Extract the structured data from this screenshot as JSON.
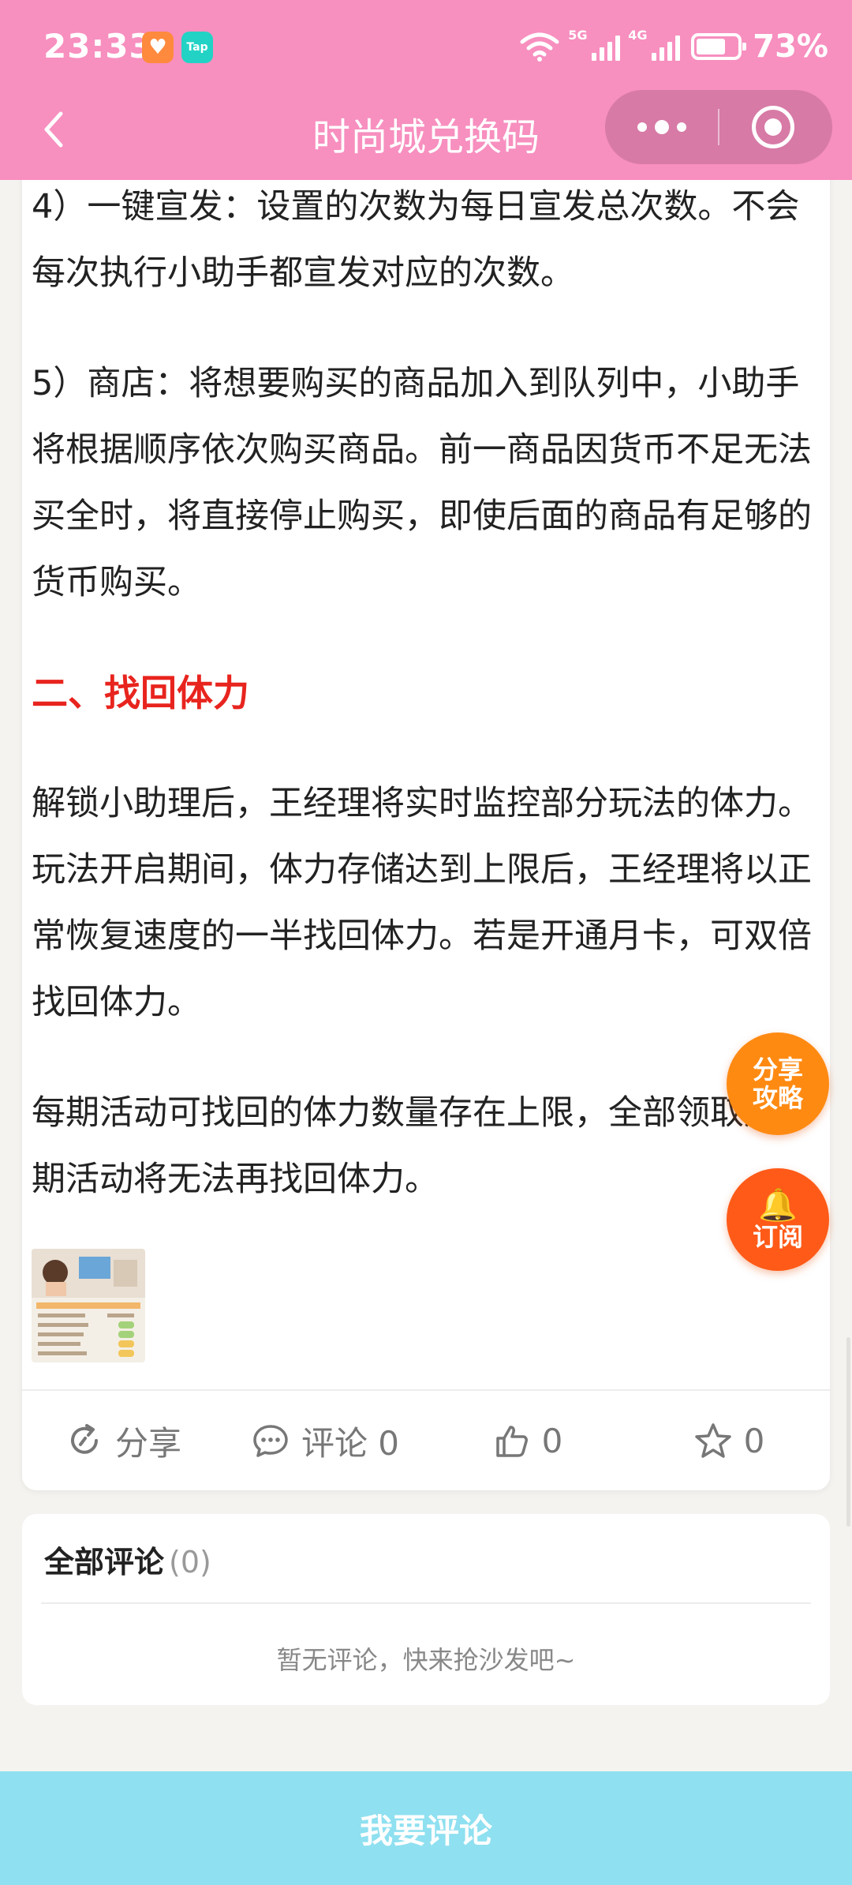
{
  "status_bar": {
    "time": "23:33",
    "net_5g": "5G",
    "net_4g": "4G",
    "battery": "73%",
    "battery_level": 0.73,
    "icons": [
      "heart-app-icon",
      "taptap-icon",
      "wifi-icon",
      "signal-icon",
      "battery-icon"
    ],
    "tap_label": "Tap"
  },
  "nav": {
    "title": "时尚城兑换码",
    "back_icon": "chevron-left-icon",
    "more_icon": "more-dots-icon",
    "close_icon": "miniapp-close-icon"
  },
  "article": {
    "paragraphs_top": [
      "4）一键宣发：设置的次数为每日宣发总次数。不会每次执行小助手都宣发对应的次数。",
      "5）商店：将想要购买的商品加入到队列中，小助手将根据顺序依次购买商品。前一商品因货币不足无法买全时，将直接停止购买，即使后面的商品有足够的货币购买。"
    ],
    "heading": "二、找回体力",
    "paragraphs_bottom": [
      "解锁小助理后，王经理将实时监控部分玩法的体力。玩法开启期间，体力存储达到上限后，王经理将以正常恢复速度的一半找回体力。若是开通月卡，可双倍找回体力。",
      "每期活动可找回的体力数量存在上限，全部领取后本期活动将无法再找回体力。"
    ],
    "heading_color": "#e8241e"
  },
  "actions": {
    "share_label": "分享",
    "comment_label": "评论 0",
    "like_count": "0",
    "fav_count": "0"
  },
  "comments": {
    "title": "全部评论",
    "count": "(0)",
    "empty_text": "暂无评论，快来抢沙发吧~"
  },
  "fab": {
    "share_line1": "分享",
    "share_line2": "攻略",
    "subscribe": "订阅"
  },
  "bottom_button": "我要评论",
  "colors": {
    "header": "#f78fbf",
    "bottom_bar": "#8fe0f0",
    "fab_share": "#ff8a12",
    "fab_subscribe": "#ff5a18"
  }
}
